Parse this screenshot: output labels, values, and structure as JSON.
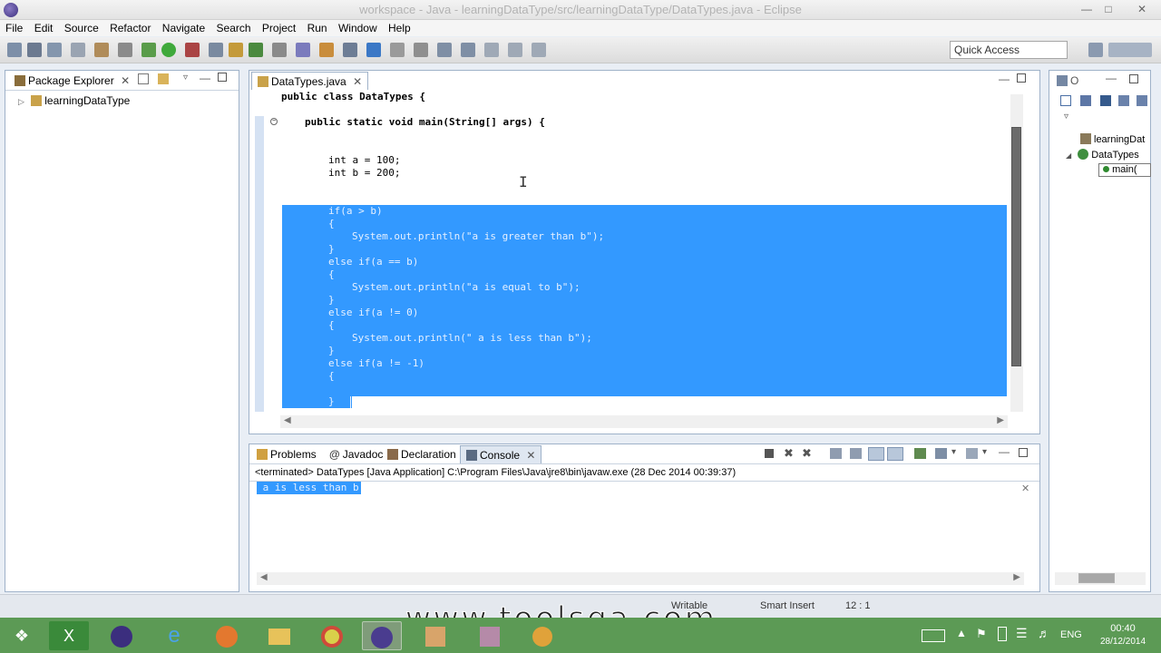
{
  "window": {
    "title": "workspace - Java - learningDataType/src/learningDataType/DataTypes.java - Eclipse"
  },
  "menu": [
    "File",
    "Edit",
    "Source",
    "Refactor",
    "Navigate",
    "Search",
    "Project",
    "Run",
    "Window",
    "Help"
  ],
  "quick_access": {
    "placeholder": "Quick Access"
  },
  "package_explorer": {
    "tab_label": "Package Explorer",
    "project": "learningDataType"
  },
  "editor": {
    "tab_label": "DataTypes.java",
    "lines": {
      "class_decl": "public class DataTypes {",
      "main_decl": "public static void main(String[] args) {",
      "int_a": "int a = 100;",
      "int_b": "int b = 200;",
      "if1": "if(a > b)",
      "brace_open1": "{",
      "print1": "System.out.println(\"a is greater than b\");",
      "brace_close1": "}",
      "if2": "else if(a == b)",
      "brace_open2": "{",
      "print2": "System.out.println(\"a is equal to b\");",
      "brace_close2": "}",
      "if3": "else if(a != 0)",
      "brace_open3": "{",
      "print3": "System.out.println(\" a is less than b\");",
      "brace_close3": "}",
      "if4": "else if(a != -1)",
      "brace_open4": "{",
      "brace_close4": "}"
    }
  },
  "outline": {
    "items": [
      "learningDat",
      "DataTypes",
      "main("
    ]
  },
  "bottom_tabs": [
    "Problems",
    "Javadoc",
    "Declaration",
    "Console"
  ],
  "console": {
    "header": "<terminated> DataTypes [Java Application] C:\\Program Files\\Java\\jre8\\bin\\javaw.exe (28 Dec 2014 00:39:37)",
    "output": " a is less than b"
  },
  "status": {
    "writable": "Writable",
    "insert_mode": "Smart Insert",
    "position": "12 : 1"
  },
  "watermark": "www.toolsqa.com",
  "taskbar": {
    "lang": "ENG",
    "time": "00:40",
    "date": "28/12/2014"
  }
}
